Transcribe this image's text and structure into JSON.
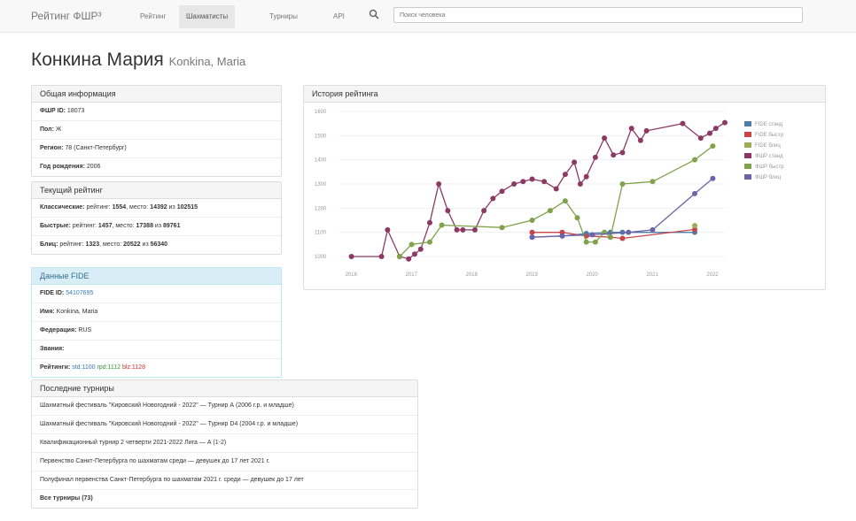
{
  "nav": {
    "brand": "Рейтинг ФШР³",
    "items": [
      {
        "label": "Рейтинг"
      },
      {
        "label": "Шахматисты"
      },
      {
        "label": "Турниры"
      },
      {
        "label": "API"
      }
    ],
    "search_placeholder": "Поиск человека"
  },
  "player": {
    "name": "Конкина Мария",
    "latin": "Konkina, Maria"
  },
  "general": {
    "title": "Общая информация",
    "id_label": "ФШР ID:",
    "id_value": "18073",
    "sex_label": "Пол:",
    "sex_value": "Ж",
    "region_label": "Регион:",
    "region_value": "78 (Санкт-Петербург)",
    "birth_label": "Год рождения:",
    "birth_value": "2006"
  },
  "current": {
    "title": "Текущий рейтинг",
    "classic_label": "Классические:",
    "classic_text": "рейтинг:",
    "classic_rating": "1554",
    "classic_place_text": ", место:",
    "classic_place": "14392",
    "classic_of": "из",
    "classic_total": "102515",
    "rapid_label": "Быстрые:",
    "rapid_text": "рейтинг:",
    "rapid_rating": "1457",
    "rapid_place_text": ", место:",
    "rapid_place": "17388",
    "rapid_of": "из",
    "rapid_total": "89761",
    "blitz_label": "Блиц:",
    "blitz_text": "рейтинг:",
    "blitz_rating": "1323",
    "blitz_place_text": ", место:",
    "blitz_place": "20522",
    "blitz_of": "из",
    "blitz_total": "56340"
  },
  "fide": {
    "title": "Данные FIDE",
    "id_label": "FIDE ID:",
    "id_value": "54107695",
    "name_label": "Имя:",
    "name_value": "Konkina, Maria",
    "fed_label": "Федерация:",
    "fed_value": "RUS",
    "titles_label": "Звания:",
    "ratings_label": "Рейтинги:",
    "std": "std:1100",
    "rpd": "rpd:1112",
    "blz": "blz:1128"
  },
  "tournaments": {
    "title": "Последние турниры",
    "items": [
      "Шахматный фестиваль \"Кировский Новогодний - 2022\" — Турнир А (2006 г.р. и младше)",
      "Шахматный фестиваль \"Кировский Новогодний - 2022\" — Турнир D4 (2004 г.р. и младше)",
      "Квалификационный турнир 2 четверти 2021-2022 Лига — А (1-2)",
      "Первенство Санкт-Петербурга по шахматам среди — девушек до 17 лет 2021 г.",
      "Полуфинал первенства Санкт-Петербурга по шахматам 2021 г. среди — девушек до 17 лет"
    ],
    "all_label": "Все турниры (73)"
  },
  "history": {
    "title": "История рейтинга"
  },
  "colors": {
    "fide_std": "#4c7ea8",
    "fide_rpd": "#c8464a",
    "fide_blz": "#9dad55",
    "fshr_std": "#8c3a63",
    "fshr_rpd": "#7fa24a",
    "fshr_blz": "#6a64a8"
  },
  "chart_data": {
    "type": "line",
    "title": "История рейтинга",
    "ylim": [
      1000,
      1600
    ],
    "yticks": [
      "1000",
      "1100",
      "1200",
      "1300",
      "1400",
      "1500",
      "1600"
    ],
    "xticks": [
      "2016",
      "2017",
      "2018",
      "2019",
      "2020",
      "2021",
      "2022"
    ],
    "xlim": [
      2015.8,
      2022.2
    ],
    "legend_position": "right",
    "series": [
      {
        "name": "FIDE станд",
        "color": "#4c7ea8",
        "points": [
          [
            2019.0,
            1080
          ],
          [
            2019.5,
            1085
          ],
          [
            2019.9,
            1095
          ],
          [
            2020.3,
            1100
          ],
          [
            2020.5,
            1100
          ],
          [
            2021.7,
            1100
          ]
        ]
      },
      {
        "name": "FIDE быстр",
        "color": "#c8464a",
        "points": [
          [
            2019.0,
            1100
          ],
          [
            2019.5,
            1100
          ],
          [
            2019.9,
            1085
          ],
          [
            2020.3,
            1080
          ],
          [
            2020.5,
            1075
          ],
          [
            2021.7,
            1112
          ]
        ]
      },
      {
        "name": "FIDE блиц",
        "color": "#9dad55",
        "points": [
          [
            2021.7,
            1128
          ]
        ]
      },
      {
        "name": "ФШР станд",
        "color": "#8c3a63",
        "points": [
          [
            2016.0,
            1000
          ],
          [
            2016.5,
            1000
          ],
          [
            2016.6,
            1110
          ],
          [
            2016.8,
            1000
          ],
          [
            2016.95,
            990
          ],
          [
            2017.05,
            1010
          ],
          [
            2017.15,
            1030
          ],
          [
            2017.3,
            1140
          ],
          [
            2017.45,
            1300
          ],
          [
            2017.6,
            1190
          ],
          [
            2017.75,
            1110
          ],
          [
            2017.85,
            1110
          ],
          [
            2018.05,
            1110
          ],
          [
            2018.2,
            1190
          ],
          [
            2018.35,
            1240
          ],
          [
            2018.5,
            1270
          ],
          [
            2018.7,
            1300
          ],
          [
            2018.85,
            1310
          ],
          [
            2019.0,
            1320
          ],
          [
            2019.2,
            1310
          ],
          [
            2019.4,
            1280
          ],
          [
            2019.55,
            1340
          ],
          [
            2019.7,
            1390
          ],
          [
            2019.8,
            1300
          ],
          [
            2019.9,
            1330
          ],
          [
            2020.05,
            1410
          ],
          [
            2020.2,
            1490
          ],
          [
            2020.35,
            1420
          ],
          [
            2020.5,
            1430
          ],
          [
            2020.65,
            1530
          ],
          [
            2020.8,
            1480
          ],
          [
            2020.9,
            1520
          ],
          [
            2021.5,
            1550
          ],
          [
            2021.8,
            1490
          ],
          [
            2021.95,
            1510
          ],
          [
            2022.05,
            1530
          ],
          [
            2022.2,
            1554
          ]
        ]
      },
      {
        "name": "ФШР быстр",
        "color": "#7fa24a",
        "points": [
          [
            2016.8,
            1000
          ],
          [
            2017.0,
            1050
          ],
          [
            2017.3,
            1060
          ],
          [
            2017.5,
            1130
          ],
          [
            2018.5,
            1120
          ],
          [
            2019.0,
            1150
          ],
          [
            2019.3,
            1190
          ],
          [
            2019.55,
            1230
          ],
          [
            2019.75,
            1160
          ],
          [
            2019.9,
            1060
          ],
          [
            2020.05,
            1060
          ],
          [
            2020.2,
            1100
          ],
          [
            2020.3,
            1080
          ],
          [
            2020.5,
            1300
          ],
          [
            2021.0,
            1310
          ],
          [
            2021.7,
            1400
          ],
          [
            2022.0,
            1457
          ]
        ]
      },
      {
        "name": "ФШР блиц",
        "color": "#6a64a8",
        "points": [
          [
            2019.0,
            1080
          ],
          [
            2019.5,
            1085
          ],
          [
            2020.0,
            1090
          ],
          [
            2020.6,
            1100
          ],
          [
            2021.0,
            1110
          ],
          [
            2021.7,
            1260
          ],
          [
            2022.0,
            1323
          ]
        ]
      }
    ]
  }
}
